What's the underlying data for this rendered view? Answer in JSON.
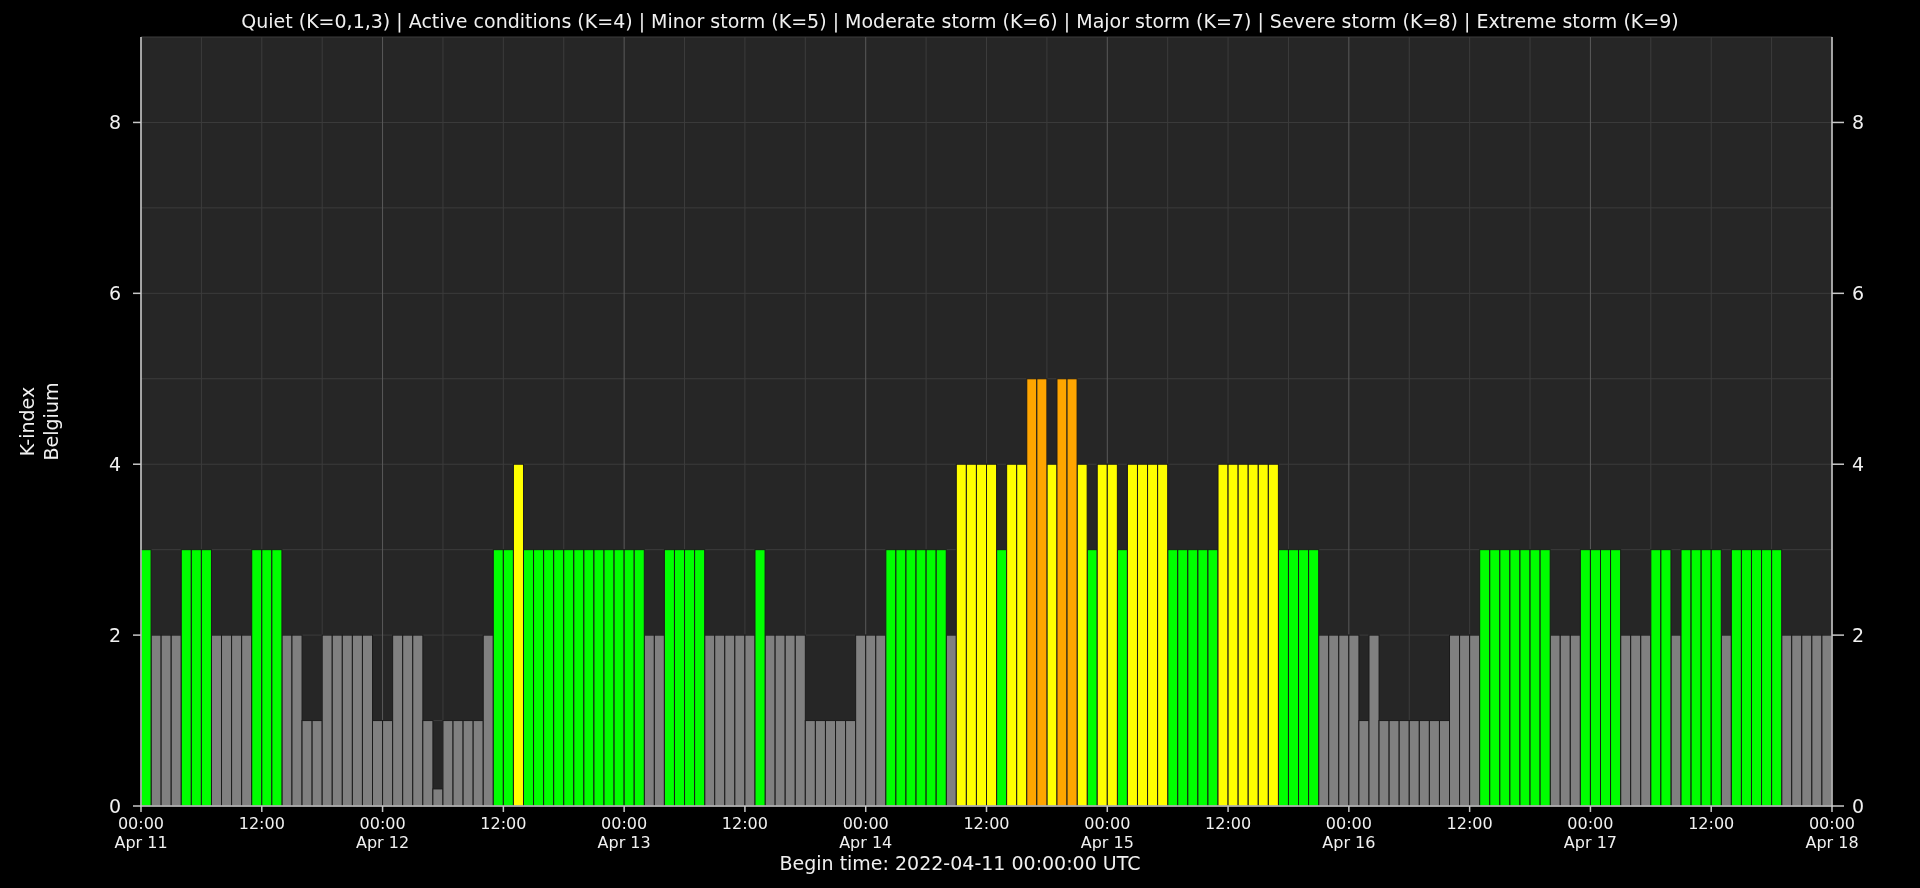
{
  "chart_data": {
    "type": "bar",
    "title": "Quiet (K=0,1,3) | Active conditions (K=4) | Minor storm (K=5) | Moderate storm (K=6) | Major storm (K=7) | Severe storm (K=8) | Extreme storm (K=9)",
    "xlabel": "Begin time: 2022-04-11 00:00:00 UTC",
    "ylabel": [
      "K-index",
      "Belgium"
    ],
    "categories": [
      "00:00\nApr 11",
      null,
      null,
      null,
      null,
      null,
      null,
      null,
      null,
      null,
      null,
      null,
      "12:00",
      null,
      null,
      null,
      null,
      null,
      null,
      null,
      null,
      null,
      null,
      null,
      "00:00\nApr 12",
      null,
      null,
      null,
      null,
      null,
      null,
      null,
      null,
      null,
      null,
      null,
      "12:00",
      null,
      null,
      null,
      null,
      null,
      null,
      null,
      null,
      null,
      null,
      null,
      "00:00\nApr 13",
      null,
      null,
      null,
      null,
      null,
      null,
      null,
      null,
      null,
      null,
      null,
      "12:00",
      null,
      null,
      null,
      null,
      null,
      null,
      null,
      null,
      null,
      null,
      null,
      "00:00\nApr 14",
      null,
      null,
      null,
      null,
      null,
      null,
      null,
      null,
      null,
      null,
      null,
      "12:00",
      null,
      null,
      null,
      null,
      null,
      null,
      null,
      null,
      null,
      null,
      null,
      "00:00\nApr 15",
      null,
      null,
      null,
      null,
      null,
      null,
      null,
      null,
      null,
      null,
      null,
      "12:00",
      null,
      null,
      null,
      null,
      null,
      null,
      null,
      null,
      null,
      null,
      null,
      "00:00\nApr 16",
      null,
      null,
      null,
      null,
      null,
      null,
      null,
      null,
      null,
      null,
      null,
      "12:00",
      null,
      null,
      null,
      null,
      null,
      null,
      null,
      null,
      null,
      null,
      null,
      "00:00\nApr 17",
      null,
      null,
      null,
      null,
      null,
      null,
      null,
      null,
      null,
      null,
      null,
      "12:00",
      null,
      null,
      null,
      null,
      null,
      null,
      null,
      null,
      null,
      null,
      null
    ],
    "ylim": [
      0,
      9
    ],
    "grid": true,
    "yticks": [
      0,
      2,
      4,
      6,
      8
    ],
    "series": [
      {
        "color": "#808080",
        "values": [
          null,
          2,
          2,
          2,
          null,
          null,
          null,
          2,
          2,
          2,
          2,
          null,
          null,
          null,
          2,
          2,
          1,
          1,
          2,
          2,
          2,
          2,
          2,
          1,
          1,
          2,
          2,
          2,
          1,
          0.2,
          1,
          1,
          1,
          1,
          2,
          null,
          null,
          null,
          null,
          null,
          null,
          null,
          null,
          null,
          null,
          null,
          null,
          null,
          null,
          null,
          2,
          2,
          null,
          null,
          null,
          null,
          2,
          2,
          2,
          2,
          2,
          null,
          2,
          2,
          2,
          2,
          1,
          1,
          1,
          1,
          1,
          2,
          2,
          2,
          null,
          null,
          null,
          null,
          null,
          null,
          2,
          null,
          null,
          null,
          null,
          null,
          null,
          null,
          null,
          null,
          null,
          null,
          null,
          null,
          null,
          null,
          null,
          null,
          null,
          null,
          null,
          null,
          null,
          null,
          null,
          null,
          null,
          null,
          null,
          null,
          null,
          null,
          null,
          null,
          null,
          null,
          null,
          2,
          2,
          2,
          2,
          1,
          2,
          1,
          1,
          1,
          1,
          1,
          1,
          1,
          2,
          2,
          2,
          null,
          null,
          null,
          null,
          null,
          null,
          null,
          2,
          2,
          2,
          null,
          null,
          null,
          null,
          2,
          2,
          2,
          null,
          null,
          2,
          null,
          null,
          null,
          null,
          2,
          null,
          null,
          null,
          null,
          null,
          2,
          2,
          2,
          2,
          2
        ]
      },
      {
        "color": "#00ff00",
        "values": [
          3,
          null,
          null,
          null,
          3,
          3,
          3,
          null,
          null,
          null,
          null,
          3,
          3,
          3,
          null,
          null,
          null,
          null,
          null,
          null,
          null,
          null,
          null,
          null,
          null,
          null,
          null,
          null,
          null,
          null,
          null,
          null,
          null,
          null,
          null,
          3,
          3,
          null,
          3,
          3,
          3,
          3,
          3,
          3,
          3,
          3,
          3,
          3,
          3,
          3,
          null,
          null,
          3,
          3,
          3,
          3,
          null,
          null,
          null,
          null,
          null,
          3,
          null,
          null,
          null,
          null,
          null,
          null,
          null,
          null,
          null,
          null,
          null,
          null,
          3,
          3,
          3,
          3,
          3,
          3,
          null,
          null,
          null,
          null,
          null,
          3,
          null,
          null,
          null,
          null,
          null,
          null,
          null,
          null,
          3,
          null,
          null,
          3,
          null,
          null,
          null,
          null,
          3,
          3,
          3,
          3,
          3,
          null,
          null,
          null,
          null,
          null,
          null,
          3,
          3,
          3,
          3,
          null,
          null,
          null,
          null,
          null,
          null,
          null,
          null,
          null,
          null,
          null,
          null,
          null,
          null,
          null,
          null,
          3,
          3,
          3,
          3,
          3,
          3,
          3,
          null,
          null,
          null,
          3,
          3,
          3,
          3,
          null,
          null,
          null,
          3,
          3,
          null,
          3,
          3,
          3,
          3,
          null,
          3,
          3,
          3,
          3,
          3,
          null,
          null,
          null,
          null,
          null
        ]
      },
      {
        "color": "#ffff00",
        "values": [
          null,
          null,
          null,
          null,
          null,
          null,
          null,
          null,
          null,
          null,
          null,
          null,
          null,
          null,
          null,
          null,
          null,
          null,
          null,
          null,
          null,
          null,
          null,
          null,
          null,
          null,
          null,
          null,
          null,
          null,
          null,
          null,
          null,
          null,
          null,
          null,
          null,
          4,
          null,
          null,
          null,
          null,
          null,
          null,
          null,
          null,
          null,
          null,
          null,
          null,
          null,
          null,
          null,
          null,
          null,
          null,
          null,
          null,
          null,
          null,
          null,
          null,
          null,
          null,
          null,
          null,
          null,
          null,
          null,
          null,
          null,
          null,
          null,
          null,
          null,
          null,
          null,
          null,
          null,
          null,
          null,
          4,
          4,
          4,
          4,
          null,
          4,
          4,
          null,
          null,
          4,
          null,
          null,
          4,
          null,
          4,
          4,
          null,
          4,
          4,
          4,
          4,
          null,
          null,
          null,
          null,
          null,
          4,
          4,
          4,
          4,
          4,
          4,
          null,
          null,
          null,
          null,
          null,
          null,
          null,
          null,
          null,
          null,
          null,
          null,
          null,
          null,
          null,
          null,
          null,
          null,
          null,
          null,
          null,
          null,
          null,
          null,
          null,
          null,
          null,
          null,
          null,
          null,
          null,
          null,
          null,
          null,
          null,
          null,
          null,
          null,
          null,
          null,
          null,
          null,
          null,
          null,
          null,
          null,
          null,
          null,
          null,
          null,
          null,
          null,
          null,
          null,
          null
        ]
      },
      {
        "color": "#ffa500",
        "values": [
          null,
          null,
          null,
          null,
          null,
          null,
          null,
          null,
          null,
          null,
          null,
          null,
          null,
          null,
          null,
          null,
          null,
          null,
          null,
          null,
          null,
          null,
          null,
          null,
          null,
          null,
          null,
          null,
          null,
          null,
          null,
          null,
          null,
          null,
          null,
          null,
          null,
          null,
          null,
          null,
          null,
          null,
          null,
          null,
          null,
          null,
          null,
          null,
          null,
          null,
          null,
          null,
          null,
          null,
          null,
          null,
          null,
          null,
          null,
          null,
          null,
          null,
          null,
          null,
          null,
          null,
          null,
          null,
          null,
          null,
          null,
          null,
          null,
          null,
          null,
          null,
          null,
          null,
          null,
          null,
          null,
          null,
          null,
          null,
          null,
          null,
          null,
          null,
          5,
          5,
          null,
          5,
          5,
          null,
          null,
          null,
          null,
          null,
          null,
          null,
          null,
          null,
          null,
          null,
          null,
          null,
          null,
          null,
          null,
          null,
          null,
          null,
          null,
          null,
          null,
          null,
          null,
          null,
          null,
          null,
          null,
          null,
          null,
          null,
          null,
          null,
          null,
          null,
          null,
          null,
          null,
          null,
          null,
          null,
          null,
          null,
          null,
          null,
          null,
          null,
          null,
          null,
          null,
          null,
          null,
          null,
          null,
          null,
          null,
          null,
          null,
          null,
          null,
          null,
          null,
          null,
          null,
          null,
          null,
          null,
          null,
          null,
          null,
          null,
          null,
          null,
          null,
          null
        ]
      }
    ]
  },
  "x_axis_end": {
    "label": "00:00\nApr 18"
  },
  "right_axis": {
    "ticks": [
      "8",
      "6",
      "4",
      "2",
      "0"
    ]
  }
}
